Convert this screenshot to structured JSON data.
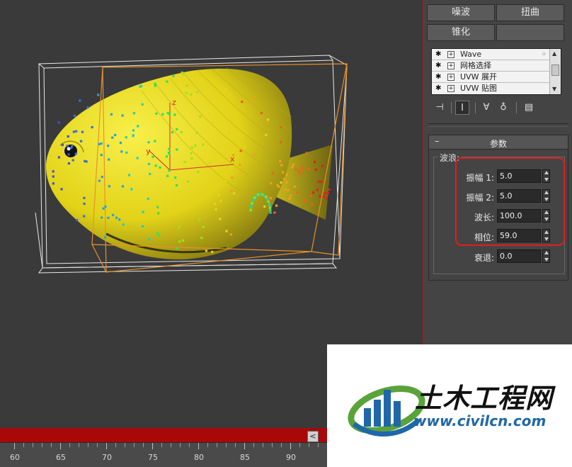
{
  "modifier_buttons": [
    {
      "label": "噪波"
    },
    {
      "label": "扭曲"
    },
    {
      "label": "锥化"
    },
    {
      "label": ""
    }
  ],
  "stack": {
    "items": [
      {
        "label": "Wave",
        "icon": "lightbulb-icon"
      },
      {
        "label": "网格选择",
        "icon": "lightbulb-icon"
      },
      {
        "label": "UVW 展开",
        "icon": "lightbulb-icon"
      },
      {
        "label": "UVW 贴图",
        "icon": "lightbulb-icon"
      }
    ]
  },
  "stack_tools": [
    {
      "icon": "pin-stack-icon",
      "glyph": "⊣"
    },
    {
      "icon": "show-end-result-icon",
      "glyph": "Ⅰ"
    },
    {
      "icon": "make-unique-icon",
      "glyph": "∀"
    },
    {
      "icon": "remove-modifier-icon",
      "glyph": "♁"
    },
    {
      "icon": "configure-modifier-sets-icon",
      "glyph": "▤"
    }
  ],
  "rollout": {
    "title": "参数",
    "collapse_symbol": "–",
    "group_label": "波浪:",
    "params": [
      {
        "label": "振幅 1:",
        "value": "5.0"
      },
      {
        "label": "振幅 2:",
        "value": "5.0"
      },
      {
        "label": "波长:",
        "value": "100.0"
      },
      {
        "label": "相位:",
        "value": "59.0"
      },
      {
        "label": "衰退:",
        "value": "0.0"
      }
    ]
  },
  "timeline": {
    "arrow": "<",
    "labels": [
      "60",
      "65",
      "70",
      "75",
      "80",
      "85",
      "90"
    ]
  },
  "viewport": {
    "gizmo_axes": {
      "x": "x",
      "y": "y",
      "z": "z"
    }
  },
  "watermark": {
    "name": "土木工程网",
    "url": "www.civilcn.com"
  },
  "colors": {
    "highlight": "#e41c1c",
    "timeline": "#a80808",
    "fish": "#e2d318",
    "gizmo": "#e8932a"
  }
}
